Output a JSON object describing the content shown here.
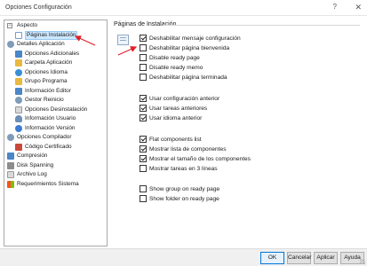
{
  "window": {
    "title": "Opciones Configuración",
    "help_glyph": "?",
    "close_glyph": "✕"
  },
  "tree": {
    "items": [
      {
        "label": "Aspecto",
        "icon": "folder-icon"
      },
      {
        "label": "Páginas Instalación",
        "icon": "page-icon",
        "selected": true
      },
      {
        "label": "Detalles Aplicación",
        "icon": "gear-icon"
      },
      {
        "label": "Opciones Adicionales",
        "icon": "options-icon"
      },
      {
        "label": "Carpeta Aplicación",
        "icon": "folder-icon"
      },
      {
        "label": "Opciones Idioma",
        "icon": "globe-icon"
      },
      {
        "label": "Grupo Programa",
        "icon": "group-icon"
      },
      {
        "label": "Información Editor",
        "icon": "editor-icon"
      },
      {
        "label": "Gestor Reinicio",
        "icon": "restart-icon"
      },
      {
        "label": "Opciones Desinstalación",
        "icon": "uninstall-icon"
      },
      {
        "label": "Información Usuario",
        "icon": "user-icon"
      },
      {
        "label": "Información Versión",
        "icon": "version-icon"
      },
      {
        "label": "Opciones Compilador",
        "icon": "compiler-icon"
      },
      {
        "label": "Código Certificado",
        "icon": "certificate-icon"
      },
      {
        "label": "Compresión",
        "icon": "compression-icon"
      },
      {
        "label": "Disk Spanning",
        "icon": "disk-icon"
      },
      {
        "label": "Archivo Log",
        "icon": "log-icon"
      },
      {
        "label": "Requerimientos Sistema",
        "icon": "windows-icon"
      }
    ]
  },
  "panel": {
    "title": "Páginas de Instalación",
    "options": [
      {
        "label": "Deshabilitar mensaje configuración",
        "checked": true
      },
      {
        "label": "Deshabilitar página bienvenida",
        "checked": false
      },
      {
        "label": "Disable ready page",
        "checked": false
      },
      {
        "label": "Disable ready memo",
        "checked": false
      },
      {
        "label": "Deshabilitar página terminada",
        "checked": false
      },
      {
        "label": "Usar configuración anterior",
        "checked": true
      },
      {
        "label": "Usar tareas anteriores",
        "checked": true
      },
      {
        "label": "Usar idioma anterior",
        "checked": true
      },
      {
        "label": "Flat components list",
        "checked": true
      },
      {
        "label": "Mostrar lista de componentes",
        "checked": true
      },
      {
        "label": "Mostrar el tamaño de los componentes",
        "checked": true
      },
      {
        "label": "Mostrar tareas en 3 líneas",
        "checked": false
      },
      {
        "label": "Show group on ready page",
        "checked": false
      },
      {
        "label": "Show folder on ready page",
        "checked": false
      }
    ]
  },
  "buttons": {
    "ok": "OK",
    "cancel": "Cancelar",
    "apply": "Aplicar",
    "help": "Ayuda"
  },
  "colors": {
    "annotation_arrow": "#e0202a",
    "selection_bg": "#cce8ff",
    "default_button_border": "#0078d7"
  }
}
